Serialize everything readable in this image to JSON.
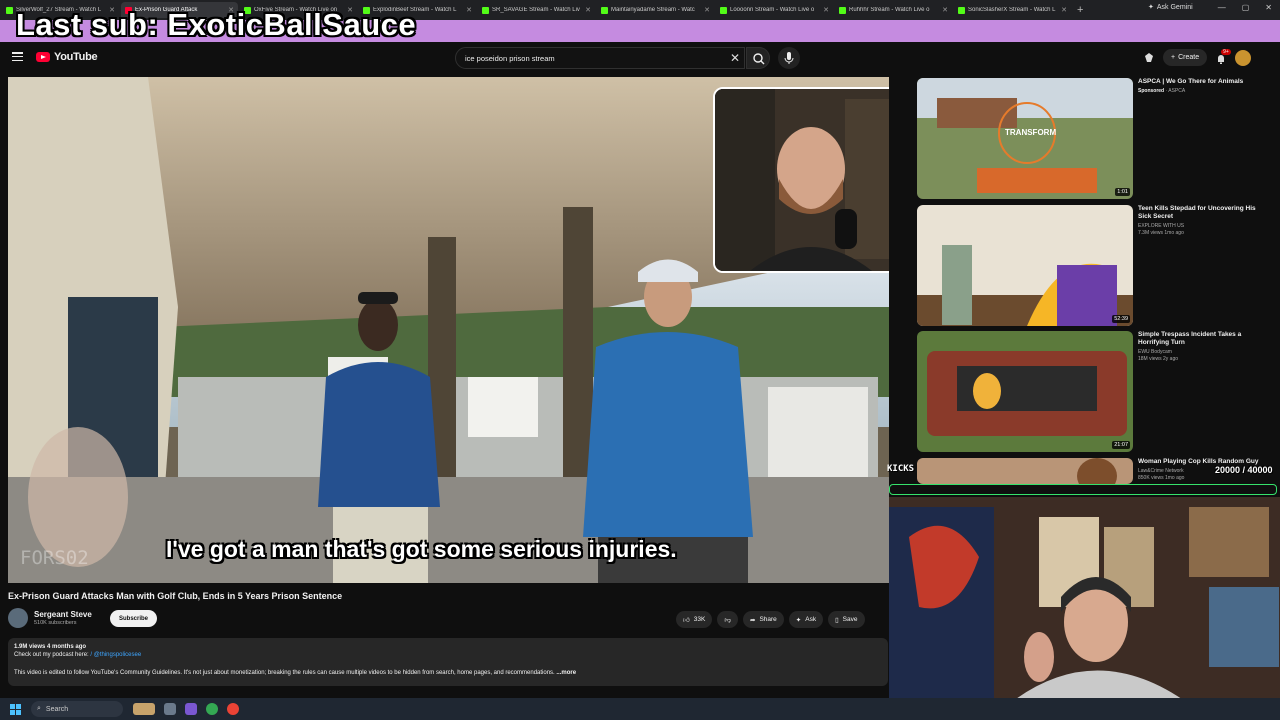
{
  "browser": {
    "tabs": [
      {
        "title": "SilverWolf_27 Stream - Watch L",
        "active": false,
        "favicon": "kick"
      },
      {
        "title": "Ex-Prison Guard Attack",
        "active": true,
        "favicon": "youtube"
      },
      {
        "title": "OxFive Stream - Watch Live on",
        "active": false,
        "favicon": "kick"
      },
      {
        "title": "ExplodinBeef Stream - Watch L",
        "active": false,
        "favicon": "kick"
      },
      {
        "title": "SR_SAVAGE Stream - Watch Liv",
        "active": false,
        "favicon": "kick"
      },
      {
        "title": "Maintainyadame Stream - Watc",
        "active": false,
        "favicon": "kick"
      },
      {
        "title": "Loooonn Stream - Watch Live o",
        "active": false,
        "favicon": "kick"
      },
      {
        "title": "Ruhhhr Stream - Watch Live o",
        "active": false,
        "favicon": "kick"
      },
      {
        "title": "SonicSlasherX Stream - Watch L",
        "active": false,
        "favicon": "kick"
      }
    ],
    "ask_gemini": "Ask Gemini"
  },
  "overlay": {
    "last_sub": "Last sub: ExoticBallSauce",
    "kicks_label": "KICKS",
    "goal_text": "20000 / 40000"
  },
  "header": {
    "logo_text": "YouTube",
    "search_value": "ice poseidon prison stream",
    "create_label": "Create",
    "notif_count": "9+"
  },
  "video": {
    "subtitle": "I've got a man that's got some serious injuries.",
    "watermark": "FORS02",
    "title": "Ex-Prison Guard Attacks Man with Golf Club, Ends in 5 Years Prison Sentence",
    "channel_name": "Sergeant Steve",
    "channel_subs": "510K subscribers",
    "subscribe_label": "Subscribe",
    "likes": "33K",
    "share_label": "Share",
    "ask_label": "Ask",
    "save_label": "Save",
    "desc_meta": "1.9M views  4 months ago",
    "desc_line2_prefix": "Check out my podcast here:",
    "desc_line2_mention": "/ @thingspolicesee",
    "desc_line3": "This video is edited to follow YouTube's Community Guidelines. It's not just about monetization; breaking the rules can cause multiple videos to be hidden from search, home pages, and recommendations.",
    "desc_more": "...more"
  },
  "recommendations": [
    {
      "title": "ASPCA | We Go There for Animals",
      "channel": "ASPCA",
      "meta": "",
      "sponsored": "Sponsored",
      "duration": "1:01",
      "thumb_text": "TRANSFORM"
    },
    {
      "title": "Teen Kills Stepdad for Uncovering His Sick Secret",
      "channel": "EXPLORE WITH US",
      "meta": "7.3M views  1mo ago",
      "sponsored": "",
      "duration": "52:39",
      "thumb_text": ""
    },
    {
      "title": "Simple Trespass Incident Takes a Horrifying Turn",
      "channel": "EWU Bodycam",
      "meta": "18M views  2y ago",
      "sponsored": "",
      "duration": "21:07",
      "thumb_text": ""
    },
    {
      "title": "Woman Playing Cop Kills Random Guy",
      "channel": "Law&Crime Network",
      "meta": "850K views  1mo ago",
      "sponsored": "",
      "duration": "",
      "thumb_text": ""
    }
  ],
  "taskbar": {
    "search_label": "Search"
  }
}
